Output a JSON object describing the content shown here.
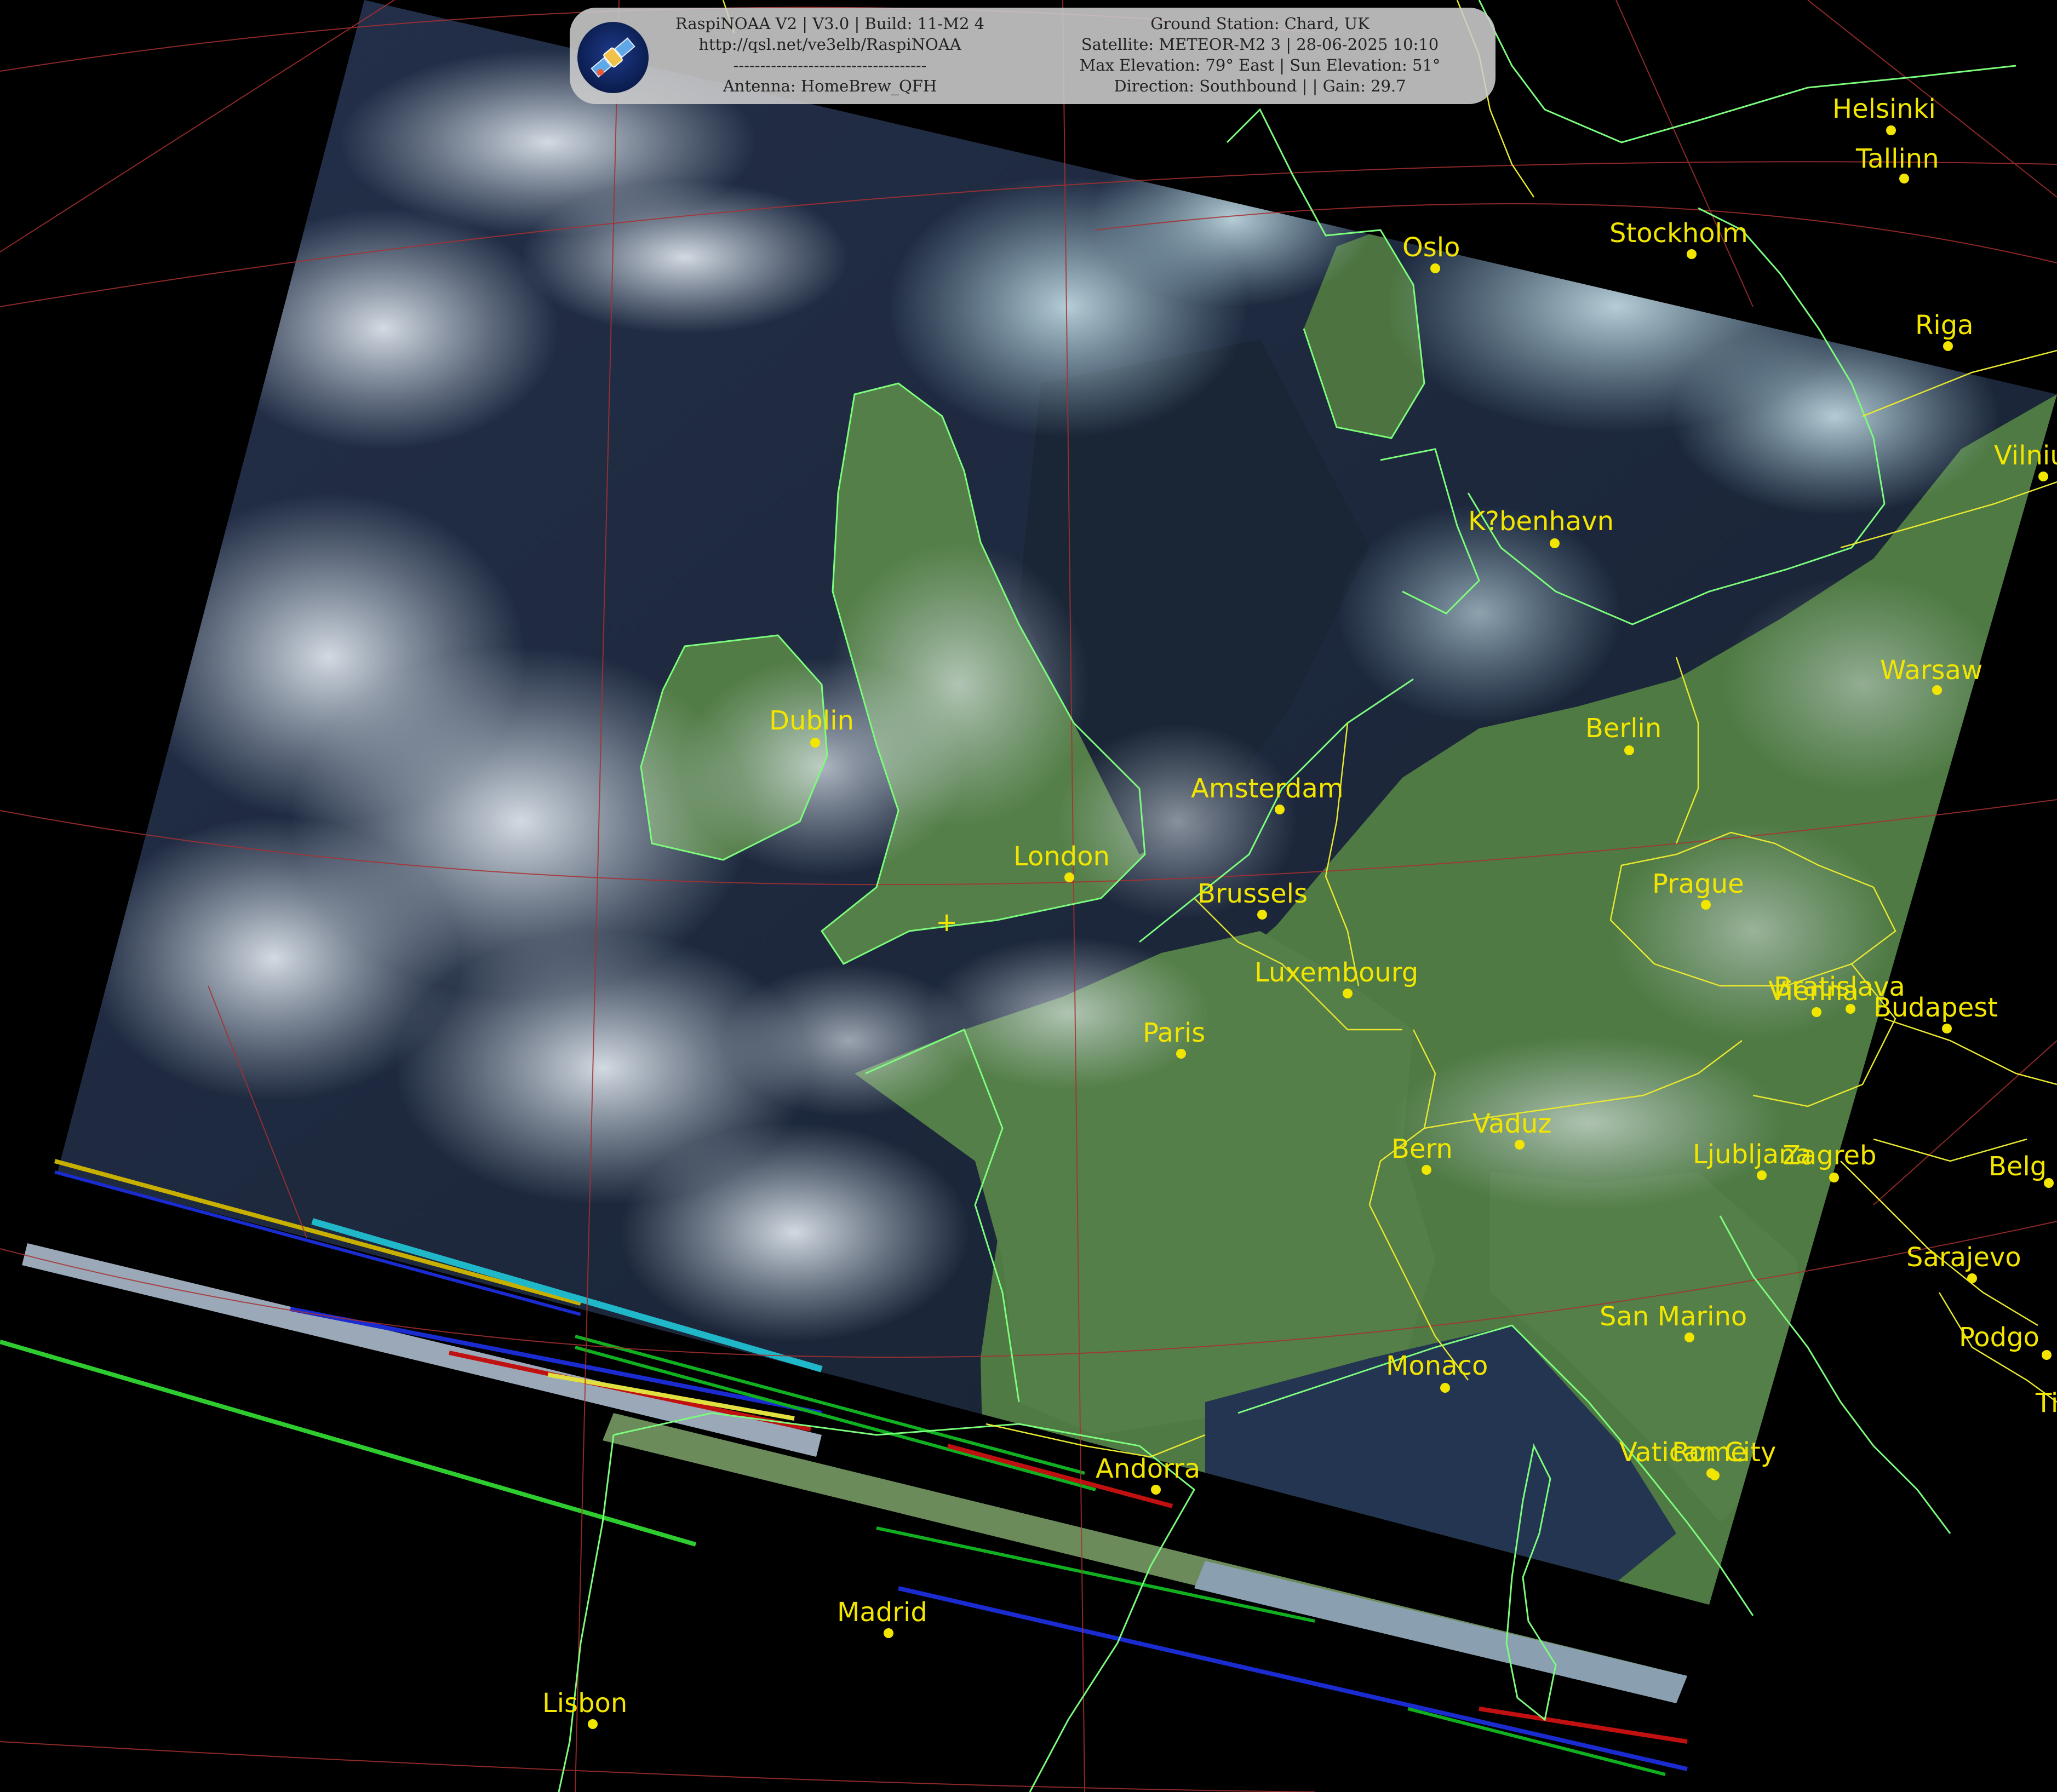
{
  "header": {
    "left": {
      "line1": "RaspiNOAA V2 | V3.0 | Build: 11-M2 4",
      "line2": "http://qsl.net/ve3elb/RaspiNOAA",
      "line3": "------------------------------------",
      "line4": "Antenna: HomeBrew_QFH"
    },
    "right": {
      "line1": "Ground Station: Chard, UK",
      "line2": "Satellite: METEOR-M2 3 | 28-06-2025 10:10",
      "line3": "Max Elevation: 79° East | Sun Elevation: 51°",
      "line4": "Direction: Southbound | | Gain: 29.7"
    },
    "logo_icon": "satellite-icon"
  },
  "cities": [
    {
      "id": "helsinki",
      "name": "Helsinki"
    },
    {
      "id": "tallinn",
      "name": "Tallinn"
    },
    {
      "id": "stockholm",
      "name": "Stockholm"
    },
    {
      "id": "oslo",
      "name": "Oslo"
    },
    {
      "id": "riga",
      "name": "Riga"
    },
    {
      "id": "vilnius",
      "name": "Vilniu"
    },
    {
      "id": "kobenhavn",
      "name": "K?benhavn"
    },
    {
      "id": "warsaw",
      "name": "Warsaw"
    },
    {
      "id": "berlin",
      "name": "Berlin"
    },
    {
      "id": "dublin",
      "name": "Dublin"
    },
    {
      "id": "amsterdam",
      "name": "Amsterdam"
    },
    {
      "id": "london",
      "name": "London"
    },
    {
      "id": "brussels",
      "name": "Brussels"
    },
    {
      "id": "prague",
      "name": "Prague"
    },
    {
      "id": "luxembourg",
      "name": "Luxembourg"
    },
    {
      "id": "vienna",
      "name": "Vienna"
    },
    {
      "id": "bratislava",
      "name": "Bratislava"
    },
    {
      "id": "budapest",
      "name": "Budapest"
    },
    {
      "id": "paris",
      "name": "Paris"
    },
    {
      "id": "vaduz",
      "name": "Vaduz"
    },
    {
      "id": "bern",
      "name": "Bern"
    },
    {
      "id": "ljubljana",
      "name": "Ljubljana"
    },
    {
      "id": "zagreb",
      "name": "Zagreb"
    },
    {
      "id": "belgrade",
      "name": "Belg"
    },
    {
      "id": "sarajevo",
      "name": "Sarajevo"
    },
    {
      "id": "sanmarino",
      "name": "San Marino"
    },
    {
      "id": "podgorica",
      "name": "Podgo"
    },
    {
      "id": "tirana",
      "name": "Ti"
    },
    {
      "id": "monaco",
      "name": "Monaco"
    },
    {
      "id": "vatican",
      "name": "Vatican City"
    },
    {
      "id": "rome",
      "name": "Rome"
    },
    {
      "id": "andorra",
      "name": "Andorra"
    },
    {
      "id": "madrid",
      "name": "Madrid"
    },
    {
      "id": "lisbon",
      "name": "Lisbon"
    }
  ],
  "ground_station_marker": "+",
  "colors": {
    "label": "#f2e600",
    "coastline": "#7cfc7c",
    "border": "#e8e830",
    "graticule": "#b03030",
    "background": "#000000",
    "ocean": "#1b2538",
    "cloud": "#d4e0ea",
    "land": "#4f7a43"
  }
}
